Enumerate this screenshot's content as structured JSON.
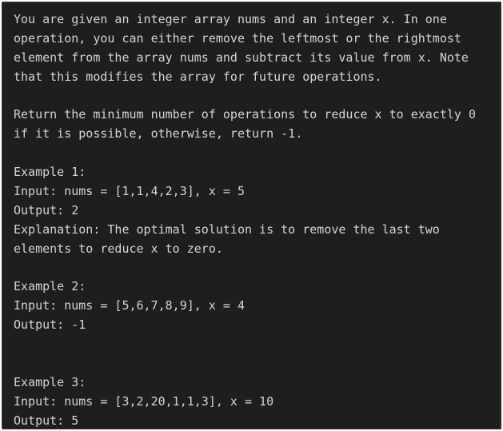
{
  "problem": {
    "lines": [
      "You are given an integer array nums and an integer x. In one",
      "operation, you can either remove the leftmost or the rightmost",
      "element from the array nums and subtract its value from x. Note",
      "that this modifies the array for future operations.",
      "",
      "Return the minimum number of operations to reduce x to exactly 0",
      "if it is possible, otherwise, return -1.",
      "",
      "Example 1:",
      "Input: nums = [1,1,4,2,3], x = 5",
      "Output: 2",
      "Explanation: The optimal solution is to remove the last two",
      "elements to reduce x to zero.",
      "",
      "Example 2:",
      "Input: nums = [5,6,7,8,9], x = 4",
      "Output: -1",
      "",
      "",
      "Example 3:",
      "Input: nums = [3,2,20,1,1,3], x = 10",
      "Output: 5"
    ]
  }
}
